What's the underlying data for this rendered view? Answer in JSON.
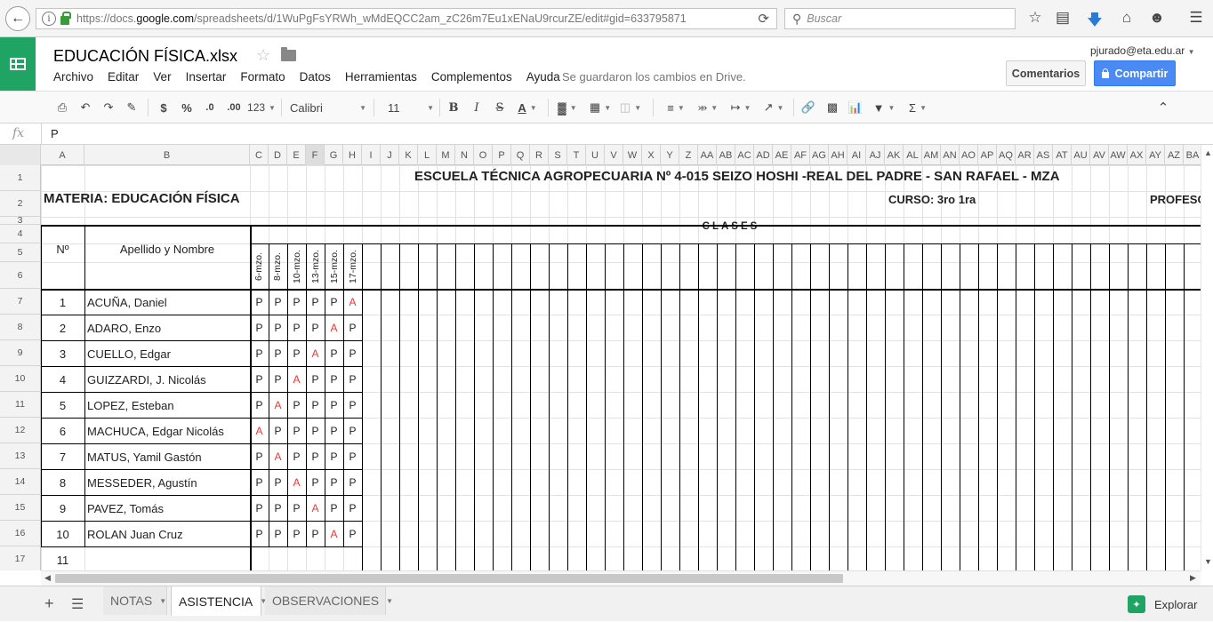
{
  "browser": {
    "url_prefix": "https://docs.",
    "url_domain": "google.com",
    "url_rest": "/spreadsheets/d/1WuPgFsYRWh_wMdEQCC2am_zC26m7Eu1xENaU9rcurZE/edit#gid=633795871",
    "search_placeholder": "Buscar",
    "icons": [
      "back-icon",
      "info-icon",
      "lock-icon",
      "reload-icon",
      "search-icon",
      "star-icon",
      "reading-list-icon",
      "download-icon",
      "home-icon",
      "smiley-icon",
      "hamburger-icon"
    ]
  },
  "doc": {
    "title": "EDUCACIÓN FÍSICA.xlsx",
    "user": "pjurado@eta.edu.ar",
    "save_status": "Se guardaron los cambios en Drive.",
    "comments_label": "Comentarios",
    "share_label": "Compartir"
  },
  "menu": [
    "Archivo",
    "Editar",
    "Ver",
    "Insertar",
    "Formato",
    "Datos",
    "Herramientas",
    "Complementos",
    "Ayuda"
  ],
  "toolbar": {
    "currency": "$",
    "percent": "%",
    "dec_less": ".0",
    "dec_more": ".00",
    "format_123": "123",
    "font": "Calibri",
    "font_size": "11",
    "bold": "B",
    "italic": "I",
    "strike": "S",
    "text_color": "A",
    "sum": "Σ"
  },
  "formula": {
    "fx": "fx",
    "value": "P"
  },
  "columns": [
    "A",
    "B",
    "C",
    "D",
    "E",
    "F",
    "G",
    "H",
    "I",
    "J",
    "K",
    "L",
    "M",
    "N",
    "O",
    "P",
    "Q",
    "R",
    "S",
    "T",
    "U",
    "V",
    "W",
    "X",
    "Y",
    "Z",
    "AA",
    "AB",
    "AC",
    "AD",
    "AE",
    "AF",
    "AG",
    "AH",
    "AI",
    "AJ",
    "AK",
    "AL",
    "AM",
    "AN",
    "AO",
    "AP",
    "AQ",
    "AR",
    "AS",
    "AT",
    "AU",
    "AV",
    "AW",
    "AX",
    "AY",
    "AZ",
    "BA"
  ],
  "selected_column": "F",
  "rows": [
    "1",
    "2",
    "3",
    "4",
    "5",
    "6",
    "7",
    "8",
    "9",
    "10",
    "11",
    "12",
    "13",
    "14",
    "15",
    "16",
    "17"
  ],
  "sheet": {
    "school_title": "ESCUELA TÉCNICA AGROPECUARIA Nº 4-015 SEIZO HOSHI -REAL DEL PADRE - SAN RAFAEL - MZA",
    "subject": "MATERIA: EDUCACIÓN FÍSICA",
    "course": "CURSO: 3ro 1ra",
    "teacher": "PROFESC",
    "classes_title": "CLASES",
    "num_header": "Nº",
    "name_header": "Apellido y Nombre",
    "dates": [
      "6-mzo.",
      "8-mzo.",
      "10-mzo.",
      "13-mzo.",
      "15-mzo.",
      "17-mzo."
    ],
    "students": [
      {
        "num": "1",
        "name": "ACUÑA, Daniel",
        "att": [
          "P",
          "P",
          "P",
          "P",
          "P",
          "A"
        ]
      },
      {
        "num": "2",
        "name": "ADARO, Enzo",
        "att": [
          "P",
          "P",
          "P",
          "P",
          "A",
          "P"
        ]
      },
      {
        "num": "3",
        "name": "CUELLO, Edgar",
        "att": [
          "P",
          "P",
          "P",
          "A",
          "P",
          "P"
        ]
      },
      {
        "num": "4",
        "name": "GUIZZARDI, J. Nicolás",
        "att": [
          "P",
          "P",
          "A",
          "P",
          "P",
          "P"
        ]
      },
      {
        "num": "5",
        "name": "LOPEZ, Esteban",
        "att": [
          "P",
          "A",
          "P",
          "P",
          "P",
          "P"
        ]
      },
      {
        "num": "6",
        "name": "MACHUCA, Edgar Nicolás",
        "att": [
          "A",
          "P",
          "P",
          "P",
          "P",
          "P"
        ]
      },
      {
        "num": "7",
        "name": "MATUS, Yamil Gastón",
        "att": [
          "P",
          "A",
          "P",
          "P",
          "P",
          "P"
        ]
      },
      {
        "num": "8",
        "name": "MESSEDER, Agustín",
        "att": [
          "P",
          "P",
          "A",
          "P",
          "P",
          "P"
        ]
      },
      {
        "num": "9",
        "name": "PAVEZ, Tomás",
        "att": [
          "P",
          "P",
          "P",
          "A",
          "P",
          "P"
        ]
      },
      {
        "num": "10",
        "name": "ROLAN Juan Cruz",
        "att": [
          "P",
          "P",
          "P",
          "P",
          "A",
          "P"
        ]
      },
      {
        "num": "11",
        "name": "",
        "att": [
          "",
          "",
          "",
          "",
          "",
          ""
        ]
      }
    ],
    "absent_color": "#e53935"
  },
  "tabs": [
    {
      "label": "NOTAS",
      "active": false
    },
    {
      "label": "ASISTENCIA",
      "active": true
    },
    {
      "label": "OBSERVACIONES",
      "active": false
    }
  ],
  "explore_label": "Explorar",
  "colors": {
    "green": "#1fa463",
    "share_blue": "#4a8af4"
  }
}
